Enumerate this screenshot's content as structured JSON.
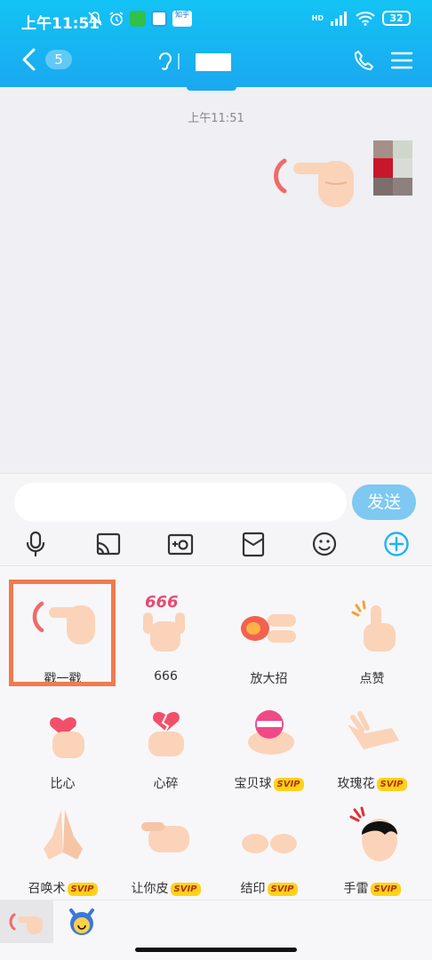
{
  "status_bar": {
    "time": "上午11:51",
    "app_badge_zhihu": "知乎",
    "network": "HD",
    "battery": "32"
  },
  "nav": {
    "unread_count": "5",
    "icons": [
      "back-arrow-icon",
      "ear-icon",
      "phone-icon",
      "menu-icon"
    ]
  },
  "chat": {
    "timestamp": "上午11:51",
    "sent_message": "poke-emoji"
  },
  "composer": {
    "placeholder": "",
    "send_label": "发送",
    "tools": [
      "microphone-icon",
      "screen-cast-icon",
      "camera-icon",
      "red-packet-icon",
      "emoji-icon",
      "plus-icon"
    ],
    "accent": "#1fb3f1"
  },
  "emoji_panel": {
    "selected_index": 0,
    "items": [
      {
        "label": "戳一戳",
        "svip": ""
      },
      {
        "label": "666",
        "svip": ""
      },
      {
        "label": "放大招",
        "svip": ""
      },
      {
        "label": "点赞",
        "svip": ""
      },
      {
        "label": "比心",
        "svip": ""
      },
      {
        "label": "心碎",
        "svip": ""
      },
      {
        "label": "宝贝球",
        "svip": "SVIP"
      },
      {
        "label": "玫瑰花",
        "svip": "SVIP"
      },
      {
        "label": "召唤术",
        "svip": "SVIP"
      },
      {
        "label": "让你皮",
        "svip": "SVIP"
      },
      {
        "label": "结印",
        "svip": "SVIP"
      },
      {
        "label": "手雷",
        "svip": "SVIP"
      }
    ],
    "image_text_666": "666"
  },
  "bottom_tabs": [
    "poke-tab",
    "devil-tab"
  ],
  "colors": {
    "header": "#1aa9f0",
    "send_button": "#7ec8f2",
    "selection_border": "#f07a4f",
    "svip_badge": "#ffd21a"
  }
}
